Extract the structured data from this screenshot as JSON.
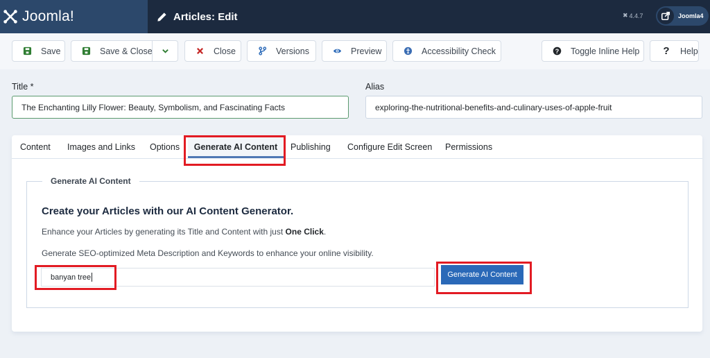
{
  "header": {
    "brand": "Joomla!",
    "title": "Articles: Edit",
    "version": "4.4.7",
    "user": "Joomla4"
  },
  "toolbar": {
    "save": "Save",
    "save_close": "Save & Close",
    "close": "Close",
    "versions": "Versions",
    "preview": "Preview",
    "accessibility": "Accessibility Check",
    "toggle_help": "Toggle Inline Help",
    "help": "Help"
  },
  "form": {
    "title_label": "Title *",
    "title_value": "The Enchanting Lilly Flower: Beauty, Symbolism, and Fascinating Facts",
    "alias_label": "Alias",
    "alias_value": "exploring-the-nutritional-benefits-and-culinary-uses-of-apple-fruit"
  },
  "tabs": [
    {
      "label": "Content"
    },
    {
      "label": "Images and Links"
    },
    {
      "label": "Options"
    },
    {
      "label": "Generate AI Content",
      "active": true
    },
    {
      "label": "Publishing"
    },
    {
      "label": "Configure Edit Screen"
    },
    {
      "label": "Permissions"
    }
  ],
  "ai": {
    "legend": "Generate AI Content",
    "heading": "Create your Articles with our AI Content Generator.",
    "p1_prefix": "Enhance your Articles by generating its Title and Content with just ",
    "p1_bold": "One Click",
    "p1_suffix": ".",
    "p2": "Generate SEO-optimized Meta Description and Keywords to enhance your online visibility.",
    "input_value": "banyan tree",
    "button": "Generate AI Content"
  },
  "colors": {
    "header_bg": "#1c2a3f",
    "brand_bg": "#2c486b",
    "primary": "#2a69b8",
    "highlight": "#e21b23",
    "save_green": "#2f7d32",
    "close_red": "#c52827"
  }
}
